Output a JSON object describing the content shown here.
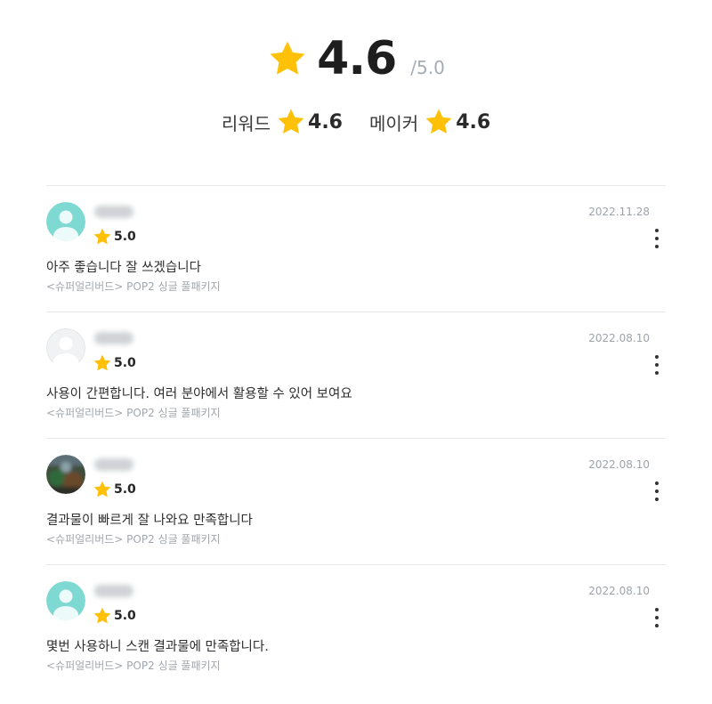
{
  "summary": {
    "overall_score": "4.6",
    "overall_max": "/5.0",
    "sub_ratings": [
      {
        "label": "리워드",
        "score": "4.6"
      },
      {
        "label": "메이커",
        "score": "4.6"
      }
    ]
  },
  "reviews": [
    {
      "rating": "5.0",
      "date": "2022.11.28",
      "text": "아주 좋습니다 잘 쓰겠습니다",
      "option": "<슈퍼얼리버드> POP2 싱글 풀패키지",
      "avatar": "teal-default-avatar"
    },
    {
      "rating": "5.0",
      "date": "2022.08.10",
      "text": "사용이 간편합니다. 여러 분야에서 활용할 수 있어 보여요",
      "option": "<슈퍼얼리버드> POP2 싱글 풀패키지",
      "avatar": "gray-default-avatar"
    },
    {
      "rating": "5.0",
      "date": "2022.08.10",
      "text": "결과물이 빠르게 잘 나와요 만족합니다",
      "option": "<슈퍼얼리버드> POP2 싱글 풀패키지",
      "avatar": "photo-avatar"
    },
    {
      "rating": "5.0",
      "date": "2022.08.10",
      "text": "몇번 사용하니 스캔 결과물에 만족합니다.",
      "option": "<슈퍼얼리버드> POP2 싱글 풀패키지",
      "avatar": "teal-default-avatar"
    }
  ],
  "colors": {
    "star": "#FFC107",
    "teal_avatar": "#7fd9d3",
    "gray_avatar": "#e9eaec",
    "divider": "#e7e8ea",
    "muted_text": "#a2a7ae"
  },
  "icons": {
    "star": "star-icon",
    "more": "more-vertical-icon"
  }
}
